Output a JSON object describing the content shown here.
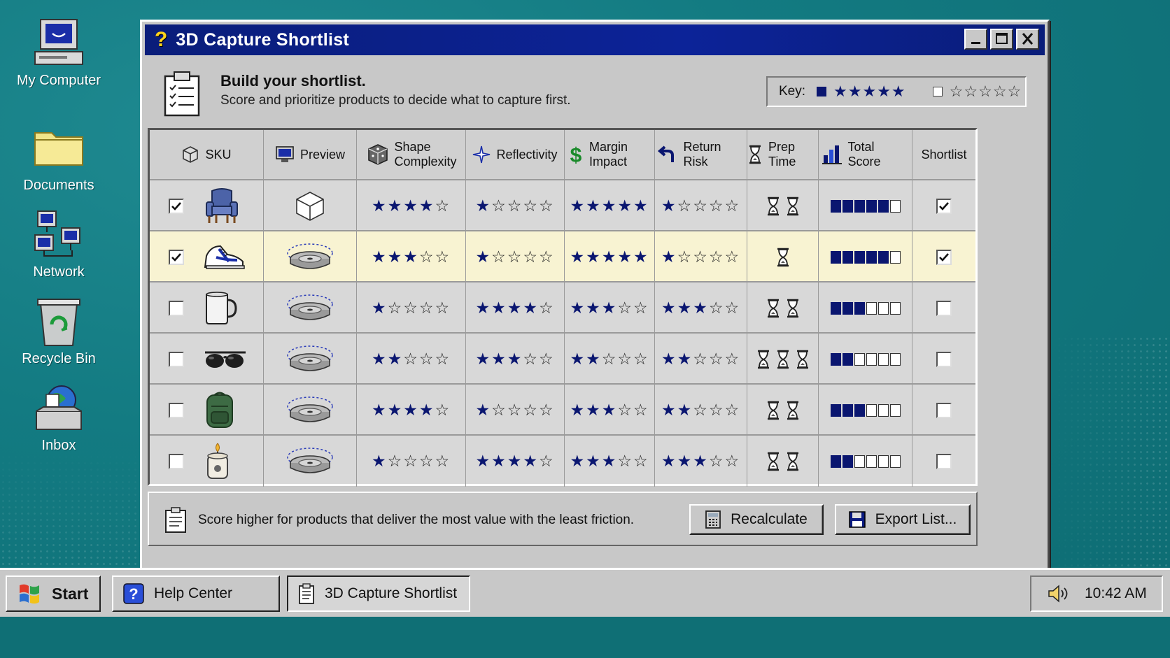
{
  "desktop": {
    "icons": [
      {
        "label": "My Computer",
        "icon": "computer-icon"
      },
      {
        "label": "Documents",
        "icon": "folder-icon"
      },
      {
        "label": "Network",
        "icon": "network-icon"
      },
      {
        "label": "Recycle Bin",
        "icon": "recycle-bin-icon"
      },
      {
        "label": "Inbox",
        "icon": "inbox-icon"
      }
    ]
  },
  "window": {
    "title": "3D Capture Shortlist",
    "title_icon": "help-question-icon"
  },
  "header": {
    "heading": "Build your shortlist.",
    "subheading": "Score and prioritize products to decide what to capture first.",
    "key_label": "Key:",
    "key_filled": "★★★★★",
    "key_empty": "☆☆☆☆☆"
  },
  "table": {
    "columns": [
      {
        "label": "SKU",
        "icon": "cube-icon"
      },
      {
        "label": "Preview",
        "icon": "monitor-icon"
      },
      {
        "label": "Shape Complexity",
        "icon": "dice-icon"
      },
      {
        "label": "Reflectivity",
        "icon": "sparkle-icon"
      },
      {
        "label": "Margin Impact",
        "icon": "dollar-icon"
      },
      {
        "label": "Return Risk",
        "icon": "return-arrow-icon"
      },
      {
        "label": "Prep Time",
        "icon": "hourglass-icon"
      },
      {
        "label": "Total Score",
        "icon": "bar-chart-icon"
      },
      {
        "label": "Shortlist",
        "icon": ""
      }
    ],
    "rows": [
      {
        "selected": true,
        "product": "armchair-icon",
        "preview": "wireframe-cube-icon",
        "shape": 4,
        "reflect": 1,
        "margin": 5,
        "return": 1,
        "prep": 2,
        "total": 5,
        "shortlist": true,
        "highlight": false
      },
      {
        "selected": true,
        "product": "sneaker-icon",
        "preview": "turntable-icon",
        "shape": 3,
        "reflect": 1,
        "margin": 5,
        "return": 1,
        "prep": 1,
        "total": 5,
        "shortlist": true,
        "highlight": true
      },
      {
        "selected": false,
        "product": "mug-icon",
        "preview": "turntable-icon",
        "shape": 1,
        "reflect": 4,
        "margin": 3,
        "return": 3,
        "prep": 2,
        "total": 3,
        "shortlist": false,
        "highlight": false
      },
      {
        "selected": false,
        "product": "sunglasses-icon",
        "preview": "turntable-icon",
        "shape": 2,
        "reflect": 3,
        "margin": 2,
        "return": 2,
        "prep": 3,
        "total": 2,
        "shortlist": false,
        "highlight": false
      },
      {
        "selected": false,
        "product": "backpack-icon",
        "preview": "turntable-icon",
        "shape": 4,
        "reflect": 1,
        "margin": 3,
        "return": 2,
        "prep": 2,
        "total": 3,
        "shortlist": false,
        "highlight": false
      },
      {
        "selected": false,
        "product": "candle-icon",
        "preview": "turntable-icon",
        "shape": 1,
        "reflect": 4,
        "margin": 3,
        "return": 3,
        "prep": 2,
        "total": 2,
        "shortlist": false,
        "highlight": false
      }
    ],
    "star_max": 5,
    "score_max": 6
  },
  "footer": {
    "tip": "Score higher for products that deliver the most value with the least friction.",
    "recalculate_label": "Recalculate",
    "export_label": "Export List..."
  },
  "taskbar": {
    "start_label": "Start",
    "tasks": [
      {
        "label": "Help Center",
        "icon": "help-question-icon"
      },
      {
        "label": "3D Capture Shortlist",
        "icon": "clipboard-icon"
      }
    ],
    "clock": "10:42 AM"
  },
  "colors": {
    "desktop": "#137b82",
    "titlebar": "#0c2398",
    "accent": "#0a1670",
    "highlight_row": "#f8f3d2"
  }
}
